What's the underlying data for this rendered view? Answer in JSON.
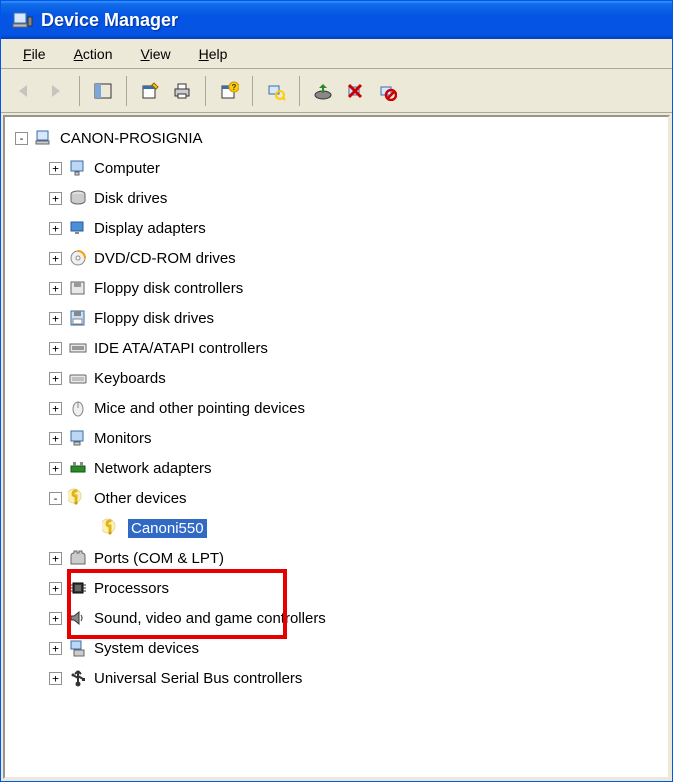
{
  "window": {
    "title": "Device Manager"
  },
  "menus": {
    "file": "File",
    "action": "Action",
    "view": "View",
    "help": "Help"
  },
  "toolbar": {
    "back": "back-icon",
    "forward": "forward-icon",
    "show_hide": "show-hide-tree-icon",
    "properties": "properties-icon",
    "print": "print-icon",
    "help": "help-icon",
    "scan": "scan-hardware-icon",
    "uninstall": "uninstall-icon",
    "disable": "disable-icon",
    "update": "update-driver-icon"
  },
  "tree": {
    "root": {
      "label": "CANON-PROSIGNIA",
      "expanded": true,
      "icon": "computer-icon"
    },
    "children": [
      {
        "label": "Computer",
        "icon": "monitor-icon",
        "expanded": false
      },
      {
        "label": "Disk drives",
        "icon": "disk-icon",
        "expanded": false
      },
      {
        "label": "Display adapters",
        "icon": "display-icon",
        "expanded": false
      },
      {
        "label": "DVD/CD-ROM drives",
        "icon": "cd-icon",
        "expanded": false
      },
      {
        "label": "Floppy disk controllers",
        "icon": "floppy-ctrl-icon",
        "expanded": false
      },
      {
        "label": "Floppy disk drives",
        "icon": "floppy-icon",
        "expanded": false
      },
      {
        "label": "IDE ATA/ATAPI controllers",
        "icon": "ide-icon",
        "expanded": false
      },
      {
        "label": "Keyboards",
        "icon": "keyboard-icon",
        "expanded": false
      },
      {
        "label": "Mice and other pointing devices",
        "icon": "mouse-icon",
        "expanded": false
      },
      {
        "label": "Monitors",
        "icon": "monitor2-icon",
        "expanded": false
      },
      {
        "label": "Network adapters",
        "icon": "network-icon",
        "expanded": false
      },
      {
        "label": "Other devices",
        "icon": "unknown-icon",
        "expanded": true,
        "children": [
          {
            "label": "Canoni550",
            "icon": "unknown-icon",
            "selected": true
          }
        ]
      },
      {
        "label": "Ports (COM & LPT)",
        "icon": "port-icon",
        "expanded": false
      },
      {
        "label": "Processors",
        "icon": "cpu-icon",
        "expanded": false
      },
      {
        "label": "Sound, video and game controllers",
        "icon": "sound-icon",
        "expanded": false
      },
      {
        "label": "System devices",
        "icon": "system-icon",
        "expanded": false
      },
      {
        "label": "Universal Serial Bus controllers",
        "icon": "usb-icon",
        "expanded": false
      }
    ]
  },
  "highlight": {
    "target": "Other devices / Canoni550"
  }
}
